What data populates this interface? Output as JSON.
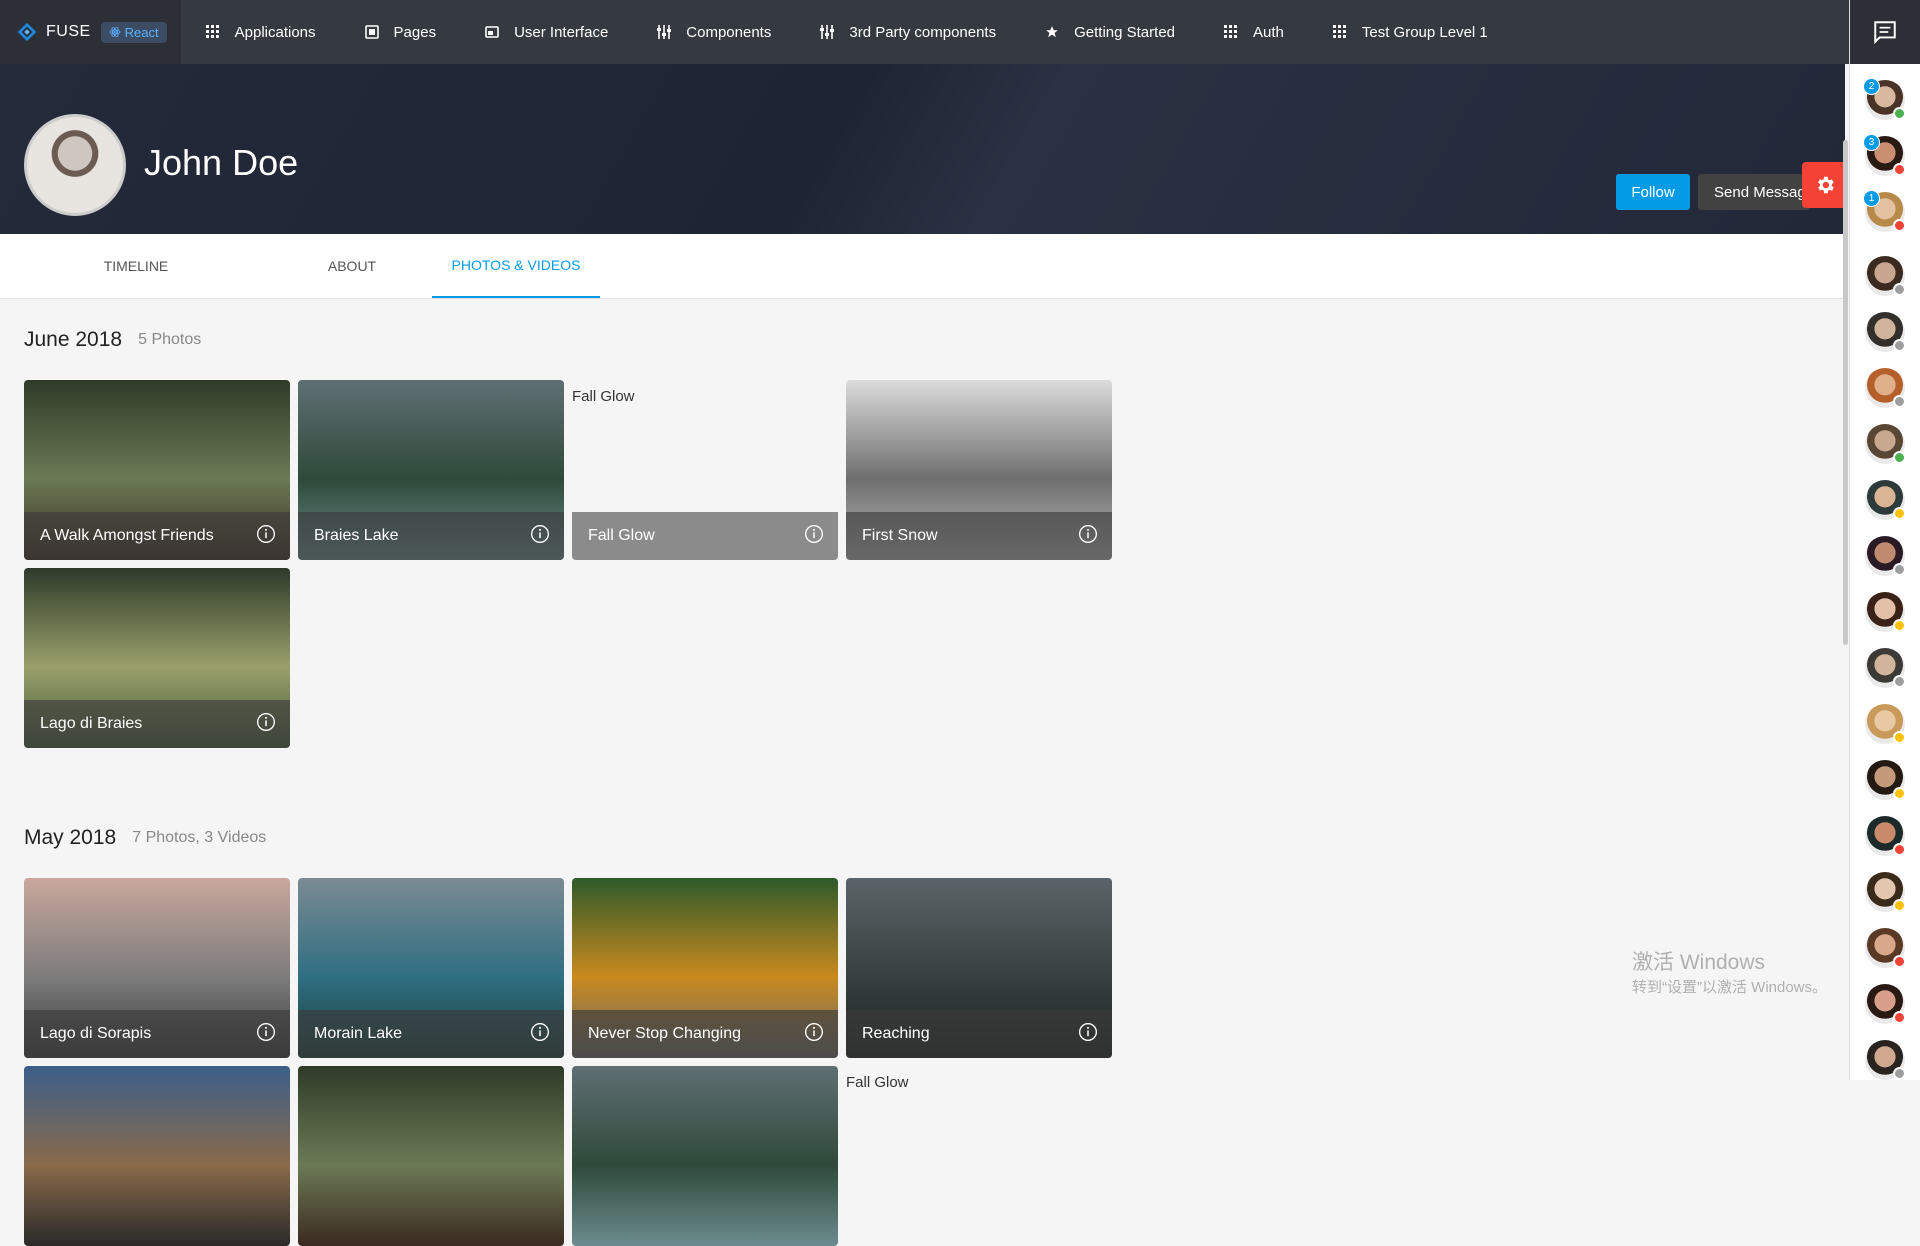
{
  "brand": {
    "name": "FUSE",
    "badge": "React",
    "accent": "#039be5"
  },
  "nav": [
    {
      "label": "Applications",
      "icon": "apps-icon"
    },
    {
      "label": "Pages",
      "icon": "pages-icon"
    },
    {
      "label": "User Interface",
      "icon": "web-icon"
    },
    {
      "label": "Components",
      "icon": "tune-icon"
    },
    {
      "label": "3rd Party components",
      "icon": "tune-icon"
    },
    {
      "label": "Getting Started",
      "icon": "star-icon"
    },
    {
      "label": "Auth",
      "icon": "apps-icon"
    },
    {
      "label": "Test Group Level 1",
      "icon": "apps-icon"
    }
  ],
  "profile": {
    "name": "John Doe",
    "follow_label": "Follow",
    "message_label": "Send Message"
  },
  "tabs": [
    {
      "label": "Timeline",
      "active": false
    },
    {
      "label": "About",
      "active": false
    },
    {
      "label": "Photos & Videos",
      "active": true
    }
  ],
  "groups": [
    {
      "name": "June 2018",
      "info": "5 Photos",
      "items": [
        {
          "title": "A Walk Amongst Friends",
          "palette": [
            "#2f3b28",
            "#6b7a55",
            "#3b2a20"
          ],
          "broken": false
        },
        {
          "title": "Braies Lake",
          "palette": [
            "#5f6f73",
            "#2f4a3a",
            "#6c8b8e"
          ],
          "broken": false
        },
        {
          "title": "Fall Glow",
          "palette": [
            "#f5f5f5",
            "#f5f5f5",
            "#f5f5f5"
          ],
          "broken": true,
          "alt": "Fall Glow"
        },
        {
          "title": "First Snow",
          "palette": [
            "#dcdcdc",
            "#6e6e6e",
            "#b9b9b9"
          ],
          "broken": false
        },
        {
          "title": "Lago di Braies",
          "palette": [
            "#2e3a2a",
            "#9aa06a",
            "#445a3a"
          ],
          "broken": false
        }
      ]
    },
    {
      "name": "May 2018",
      "info": "7 Photos, 3 Videos",
      "items": [
        {
          "title": "Lago di Sorapis",
          "palette": [
            "#c9a79c",
            "#7c7c7c",
            "#3b3b3b"
          ],
          "broken": false
        },
        {
          "title": "Morain Lake",
          "palette": [
            "#7b8a92",
            "#2f6f82",
            "#1e3e3a"
          ],
          "broken": false
        },
        {
          "title": "Never Stop Changing",
          "palette": [
            "#2e5a2a",
            "#c9891f",
            "#6b6b6b"
          ],
          "broken": false
        },
        {
          "title": "Reaching",
          "palette": [
            "#5a6468",
            "#38403f",
            "#1c2222"
          ],
          "broken": false
        },
        {
          "title": "",
          "palette": [
            "#3b5f8a",
            "#8a6a4a",
            "#2a2a2a"
          ],
          "broken": false
        },
        {
          "title": "",
          "palette": [
            "#2f3b28",
            "#6b7a55",
            "#3b2a20"
          ],
          "broken": false
        },
        {
          "title": "",
          "palette": [
            "#5f6f73",
            "#2f4a3a",
            "#6c8b8e"
          ],
          "broken": false
        },
        {
          "title": "",
          "palette": [
            "#f5f5f5",
            "#f5f5f5",
            "#f5f5f5"
          ],
          "broken": true,
          "alt": "Fall Glow"
        }
      ]
    }
  ],
  "contacts": [
    {
      "unread": "2",
      "status": "#4caf50",
      "skin": "#d9b8a0",
      "hair": "#4a3428"
    },
    {
      "unread": "3",
      "status": "#f44336",
      "skin": "#c98f70",
      "hair": "#2a1a14"
    },
    {
      "unread": "1",
      "status": "#f44336",
      "skin": "#e3c0a0",
      "hair": "#b88a4a"
    },
    {
      "unread": "",
      "status": "#9e9e9e",
      "skin": "#c9a690",
      "hair": "#3a2a20"
    },
    {
      "unread": "",
      "status": "#9e9e9e",
      "skin": "#d1b49c",
      "hair": "#33302c"
    },
    {
      "unread": "",
      "status": "#9e9e9e",
      "skin": "#e0b08a",
      "hair": "#b5602a"
    },
    {
      "unread": "",
      "status": "#4caf50",
      "skin": "#c9a890",
      "hair": "#5a4634"
    },
    {
      "unread": "",
      "status": "#ffc107",
      "skin": "#d9b596",
      "hair": "#2c3a3a"
    },
    {
      "unread": "",
      "status": "#9e9e9e",
      "skin": "#c08a70",
      "hair": "#2a1a24"
    },
    {
      "unread": "",
      "status": "#ffc107",
      "skin": "#e3c0a8",
      "hair": "#3a2218"
    },
    {
      "unread": "",
      "status": "#9e9e9e",
      "skin": "#d1b49c",
      "hair": "#3c3a36"
    },
    {
      "unread": "",
      "status": "#ffc107",
      "skin": "#e8c9a4",
      "hair": "#c99a5a"
    },
    {
      "unread": "",
      "status": "#ffc107",
      "skin": "#c49a7a",
      "hair": "#241a14"
    },
    {
      "unread": "",
      "status": "#f44336",
      "skin": "#c88a6a",
      "hair": "#1c2a2a"
    },
    {
      "unread": "",
      "status": "#ffc107",
      "skin": "#e2c6b0",
      "hair": "#3a2a1a"
    },
    {
      "unread": "",
      "status": "#f44336",
      "skin": "#d9a88a",
      "hair": "#5a3a24"
    },
    {
      "unread": "",
      "status": "#f44336",
      "skin": "#d8a08a",
      "hair": "#2a1a14"
    },
    {
      "unread": "",
      "status": "#9e9e9e",
      "skin": "#d0a890",
      "hair": "#2a2420"
    }
  ],
  "watermark": {
    "line1": "激活 Windows",
    "line2": "转到“设置”以激活 Windows。"
  }
}
